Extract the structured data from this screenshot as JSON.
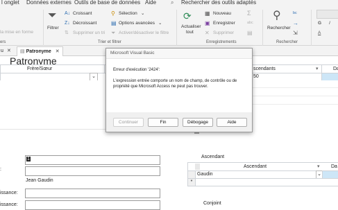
{
  "menu": {
    "items": [
      "l onglet",
      "Données externes",
      "Outils de base de données",
      "Aide"
    ],
    "search": "Rechercher des outils adaptés"
  },
  "ribbon": {
    "filter_label": "Filtrer",
    "sort_asc": "Croissant",
    "sort_desc": "Décroissant",
    "remove_sort": "Supprimer un tri",
    "selection": "Sélection",
    "advanced_options": "Options avancées",
    "toggle_filter": "Activer/désactiver le filtre",
    "refresh_line1": "Actualiser",
    "refresh_line2": "tout",
    "new_record": "Nouveau",
    "save_record": "Enregistrer",
    "delete_record": "Supprimer",
    "find_label": "Rechercher",
    "format_painter": "la mise en forme",
    "group_sort_filter": "Trier et filtrer",
    "group_records": "Enregistrements",
    "group_find": "Rechercher",
    "group_clipboard": "ers",
    "font_g": "G",
    "font_i": "I",
    "font_a": "A"
  },
  "tabs": {
    "prev": "u",
    "close_prev": "✕",
    "active": "Patronyme",
    "close_active": "✕"
  },
  "form": {
    "title": "Patronyme",
    "col_frere_soeur": "Frère/Sœur",
    "col_ascendants": "scendants",
    "col_da": "Da",
    "row_value": "50",
    "field_value": "1",
    "name_value": "Jean Gaudin",
    "label_colon": ":",
    "label_naissance1": "issance:",
    "label_naissance2": "issance:",
    "ascendant_title": "Ascendant",
    "ascendant_col": "Ascendant",
    "ascendant_value": "Gaudin",
    "conjoint_title": "Conjoint",
    "new_row_marker": "*"
  },
  "dialog": {
    "title": "Microsoft Visual Basic",
    "error_line": "Erreur d'exécution '2424':",
    "message_line1": "L'expression entrée comporte un nom de champ, de contrôle ou de",
    "message_line2": "propriété que Microsoft Access ne peut pas trouver.",
    "btn_continue": "Continuer",
    "btn_end": "Fin",
    "btn_debug": "Débogage",
    "btn_help": "Aide"
  },
  "colors": {
    "accent": "#0078d4",
    "grid_border": "#cfd3d8",
    "selection": "#cde6f7"
  }
}
